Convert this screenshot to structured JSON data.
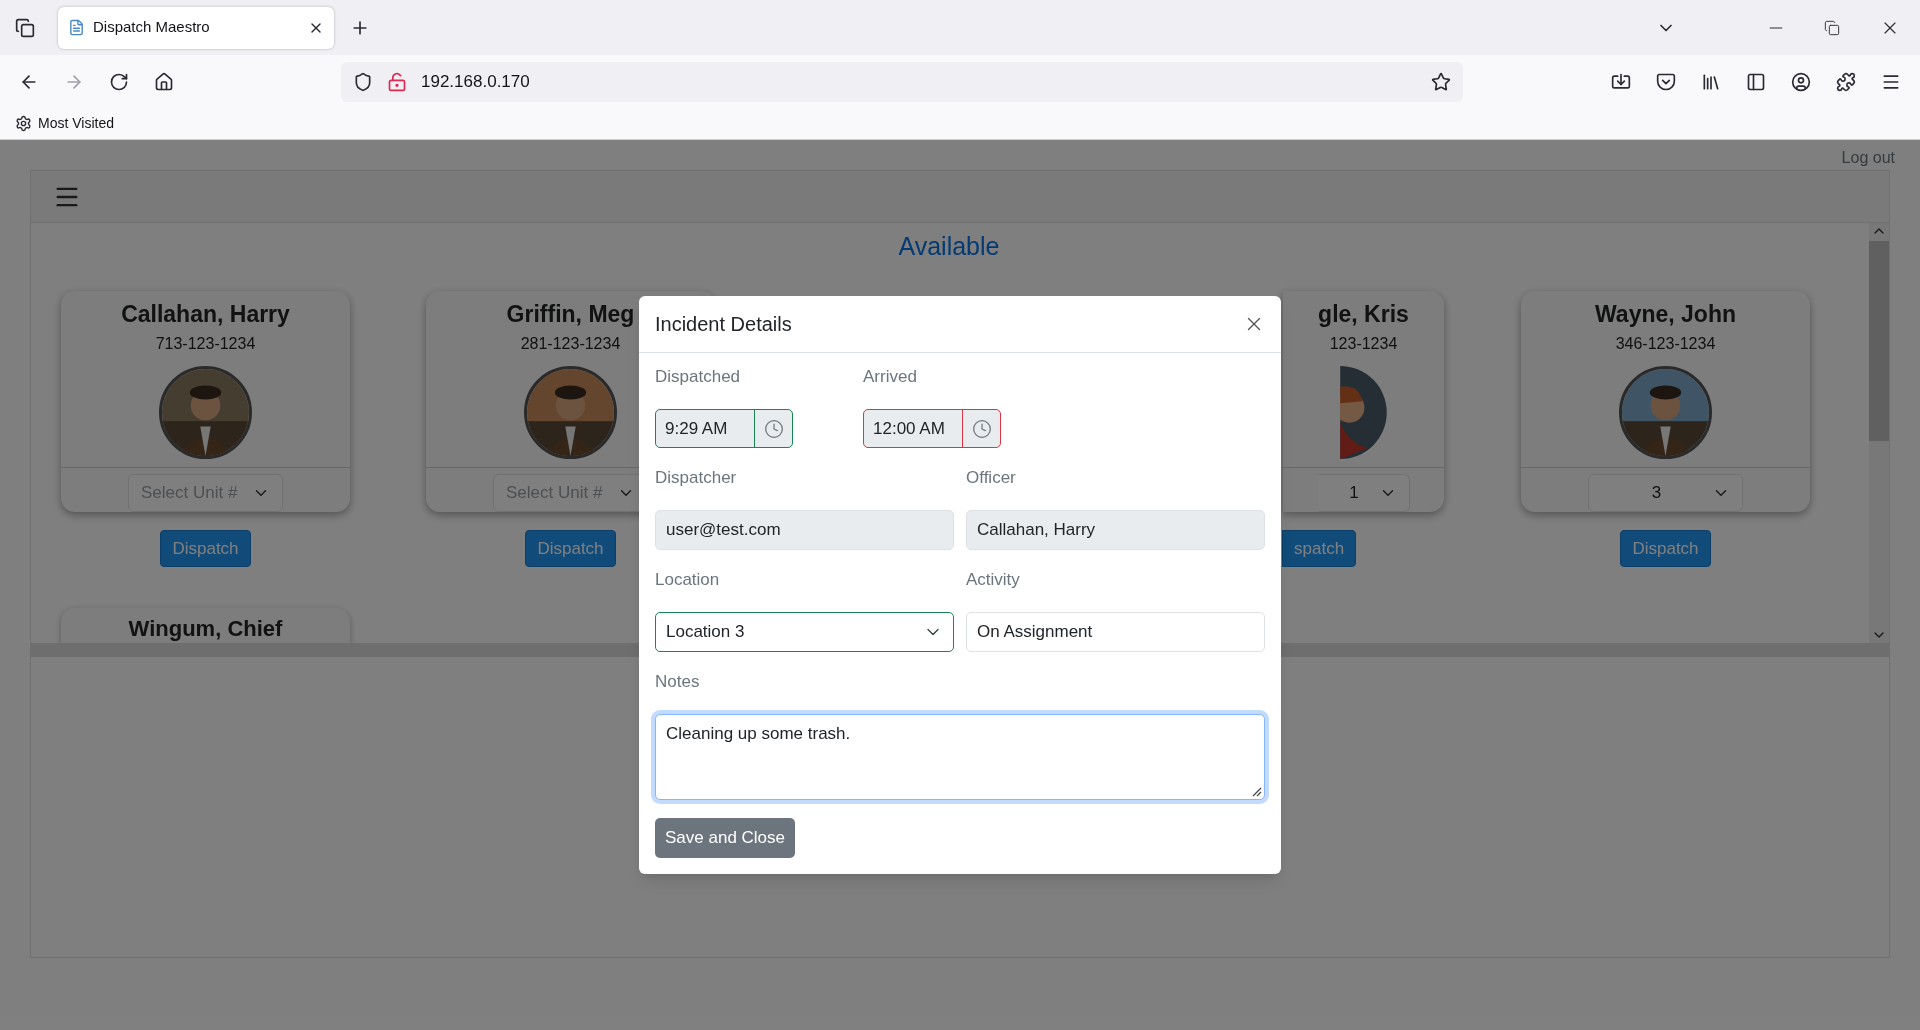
{
  "browser": {
    "tab_title": "Dispatch Maestro",
    "url": "192.168.0.170",
    "bookmarks": [
      "Most Visited"
    ]
  },
  "header": {
    "logout": "Log out"
  },
  "section_title": "Available",
  "cards": [
    {
      "kind": "full",
      "name": "Callahan, Harry",
      "phone": "713-123-1234",
      "unit": {
        "placeholder": "Select Unit #"
      },
      "button": "Dispatch"
    },
    {
      "kind": "full",
      "name": "Griffin, Meg",
      "phone": "281-123-1234",
      "unit": {
        "placeholder": "Select Unit #"
      },
      "button": "Dispatch"
    },
    {
      "kind": "cut",
      "name": "gle, Kris",
      "phone": "123-1234",
      "unit": {
        "value": "1"
      },
      "button": "spatch"
    },
    {
      "kind": "full",
      "name": "Wayne, John",
      "phone": "346-123-1234",
      "unit": {
        "value": "3"
      },
      "button": "Dispatch"
    },
    {
      "kind": "peek",
      "name": "Wingum, Chief"
    }
  ],
  "modal": {
    "title": "Incident Details",
    "rows": [
      [
        {
          "kind": "time",
          "label": "Dispatched",
          "value": "9:29 AM",
          "valid": true
        },
        {
          "kind": "time",
          "label": "Arrived",
          "value": "12:00 AM",
          "valid": false
        }
      ],
      [
        {
          "kind": "text",
          "label": "Dispatcher",
          "value": "user@test.com",
          "readonly": true
        },
        {
          "kind": "text",
          "label": "Officer",
          "value": "Callahan, Harry",
          "readonly": true
        }
      ],
      [
        {
          "kind": "select",
          "label": "Location",
          "value": "Location 3",
          "valid": true
        },
        {
          "kind": "text",
          "label": "Activity",
          "value": "On Assignment",
          "readonly": false
        }
      ],
      [
        {
          "kind": "textarea",
          "label": "Notes",
          "value": "Cleaning up some trash.",
          "focused": true
        }
      ]
    ],
    "button": "Save and Close"
  }
}
